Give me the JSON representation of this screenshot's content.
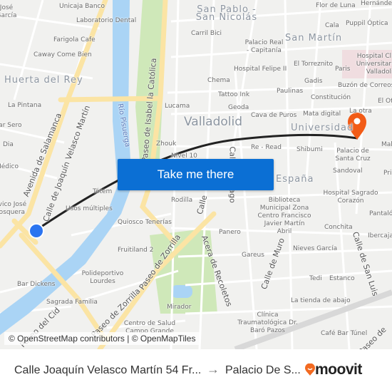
{
  "map": {
    "labels": [
      "Unicaja Banco",
      "Laboratorio Dental",
      "Farigola Cafe",
      "Caway Come Bien",
      "Huerta del Rey",
      "La Pintana",
      "Bar Sero",
      "Dia",
      "Lucama",
      "Zhouk",
      "Nivel 10",
      "San Pablo - San Nicolás",
      "Carril Bici",
      "Palacio Real - Capitanía",
      "San Martín",
      "Flor de Luna",
      "Cala",
      "Puppil Óptica",
      "Hospital Clínico Universitario de Valladolid",
      "El Torreznito",
      "Hospital Felipe II",
      "Paris",
      "Chema",
      "Gadis",
      "Buzón de Correos",
      "Tattoo Ink",
      "Paulinas",
      "Constitución",
      "Geoda",
      "Cava de Puros",
      "Mata digital",
      "La otra",
      "Valladolid",
      "Universidad",
      "Re - Read",
      "Shibumi",
      "Palacio de Santa Cruz",
      "Sandoval",
      "España",
      "Hospital Sagrado Corazón",
      "Rodilla",
      "Tótem",
      "Usos múltiples",
      "Quiosco Tenerías",
      "Fruitiland 2",
      "Biblioteca Municipal Zona Centro Francisco Javier Martín Abril",
      "Conchita",
      "Panero",
      "Nieves García",
      "Gareus",
      "Polideportivo Lourdes",
      "Bar Dickens",
      "Sagrada Familia",
      "Mirador",
      "Centro de Salud Campo Grande",
      "Tedi",
      "Estanco",
      "La tienda de abajo",
      "Clínica Traumatológica Dr. Baró Pazos",
      "Café Bar Túnel",
      "Ibercaja",
      "Pantaló",
      "Hernández",
      "Médico",
      "Cívico José Mosquera",
      "José García",
      "El Ot",
      "Mal",
      "Pri"
    ],
    "streets": [
      "Avenida de Salamanca",
      "Calle de Joaquín Velasco Martín",
      "Río Pisuerga",
      "Paseo de Isabel la Católica",
      "Paseo de Zorrilla",
      "Paseo de Zorrilla",
      "Acera de Recoletos",
      "Calle de Muro",
      "Calle de San Luis",
      "Calle Santiago",
      "Paseo del Cid",
      "Calle",
      "Paseo de"
    ],
    "colors": {
      "route": "#222222",
      "origin": "#2a74f0",
      "destination": "#f25b16",
      "button": "#0b6fd4",
      "river": "#aad4f5",
      "main_road": "#fbe4a4",
      "park": "#cfe8b9"
    }
  },
  "button": {
    "label": "Take me there"
  },
  "attribution": "© OpenStreetMap contributors | © OpenMapTiles",
  "bottom_bar": {
    "origin": "Calle Joaquín Velasco Martín 54 Fr...",
    "arrow_icon": "arrow-right",
    "destination": "Palacio De S...",
    "brand": "moovit",
    "brand_color": "#f26a21"
  }
}
